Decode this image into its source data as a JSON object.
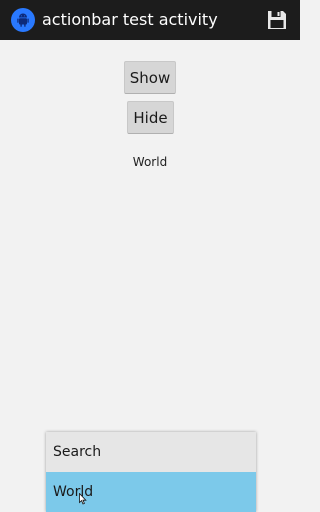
{
  "action_bar": {
    "title": "actionbar test activity",
    "app_icon": "android-robot-icon",
    "action_icon": "save-floppy-icon",
    "background": "#1c1c1c",
    "icon_color": "#2979ff"
  },
  "main": {
    "show_button_label": "Show",
    "hide_button_label": "Hide",
    "message": "World"
  },
  "popup_menu": {
    "items": [
      {
        "label": "Search",
        "selected": false
      },
      {
        "label": "World",
        "selected": true
      }
    ],
    "selected_color": "#7cc9ea"
  }
}
